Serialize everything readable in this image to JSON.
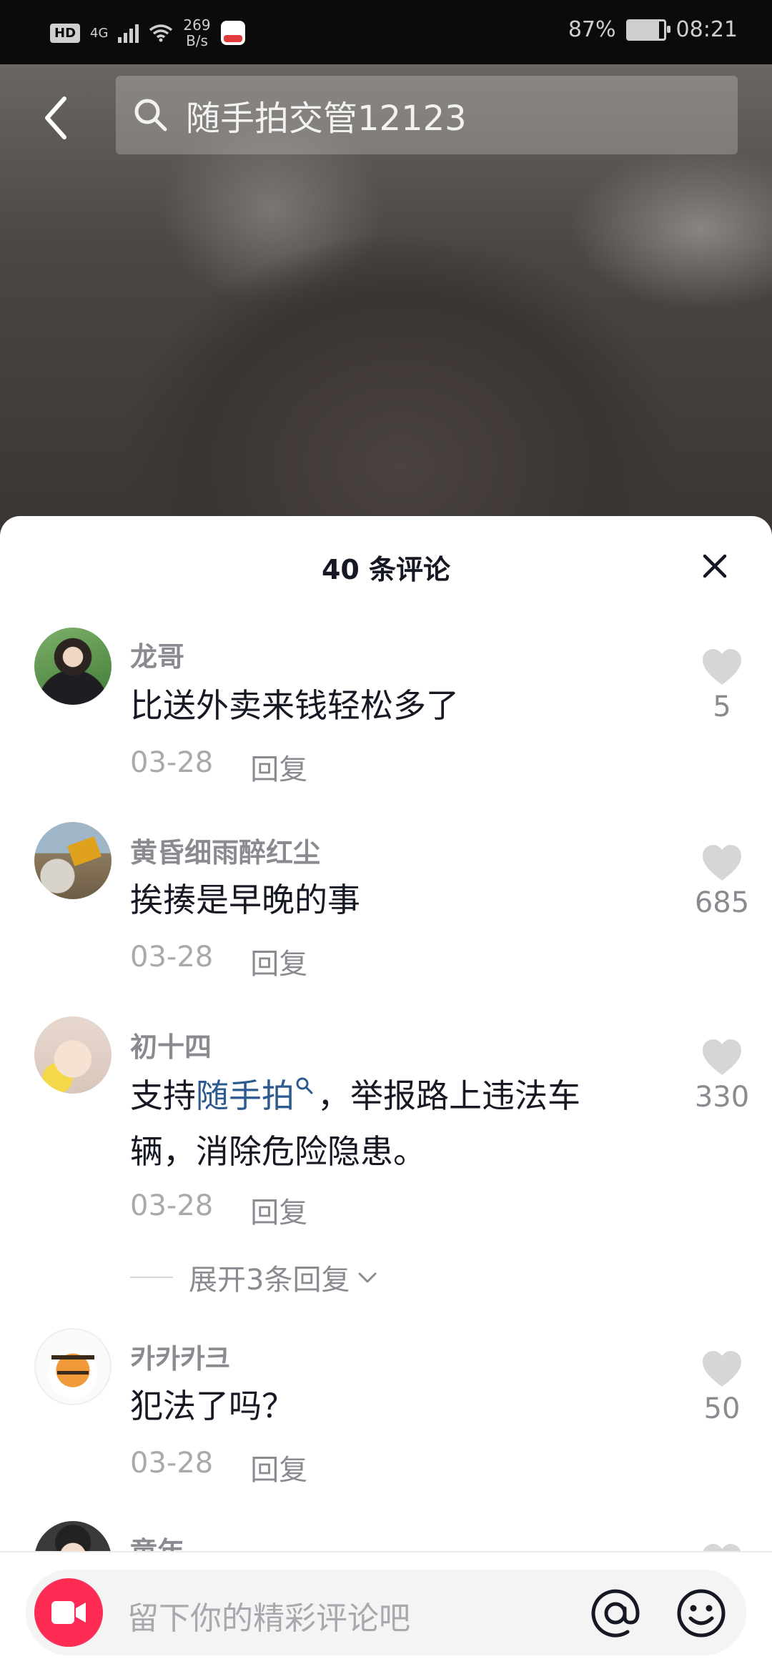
{
  "status_bar": {
    "hd": "HD",
    "network": "4G",
    "speed_value": "269",
    "speed_unit": "B/s",
    "battery": "87%",
    "battery_level": 0.87,
    "time": "08:21"
  },
  "search": {
    "query": "随手拍交管12123"
  },
  "comments_panel": {
    "title": "40 条评论"
  },
  "comments": [
    {
      "user": "龙哥",
      "text": "比送外卖来钱轻松多了",
      "date": "03-28",
      "reply": "回复",
      "likes": "5"
    },
    {
      "user": "黄昏细雨醉红尘",
      "text": "挨揍是早晚的事",
      "date": "03-28",
      "reply": "回复",
      "likes": "685"
    },
    {
      "user": "初十四",
      "text_prefix": "支持",
      "text_link": "随手拍",
      "text_suffix_1": "，举报路上违法车",
      "text_suffix_2": "辆，消除危险隐患。",
      "date": "03-28",
      "reply": "回复",
      "likes": "330",
      "expand": "展开3条回复"
    },
    {
      "user": "카카카크",
      "text": "犯法了吗？",
      "date": "03-28",
      "reply": "回复",
      "likes": "50"
    },
    {
      "user": "童年"
    }
  ],
  "input": {
    "placeholder": "留下你的精彩评论吧"
  },
  "colors": {
    "accent": "#fe2c55",
    "link": "#2d5a8f",
    "text_primary": "#161823",
    "text_secondary": "#8a8b91"
  }
}
